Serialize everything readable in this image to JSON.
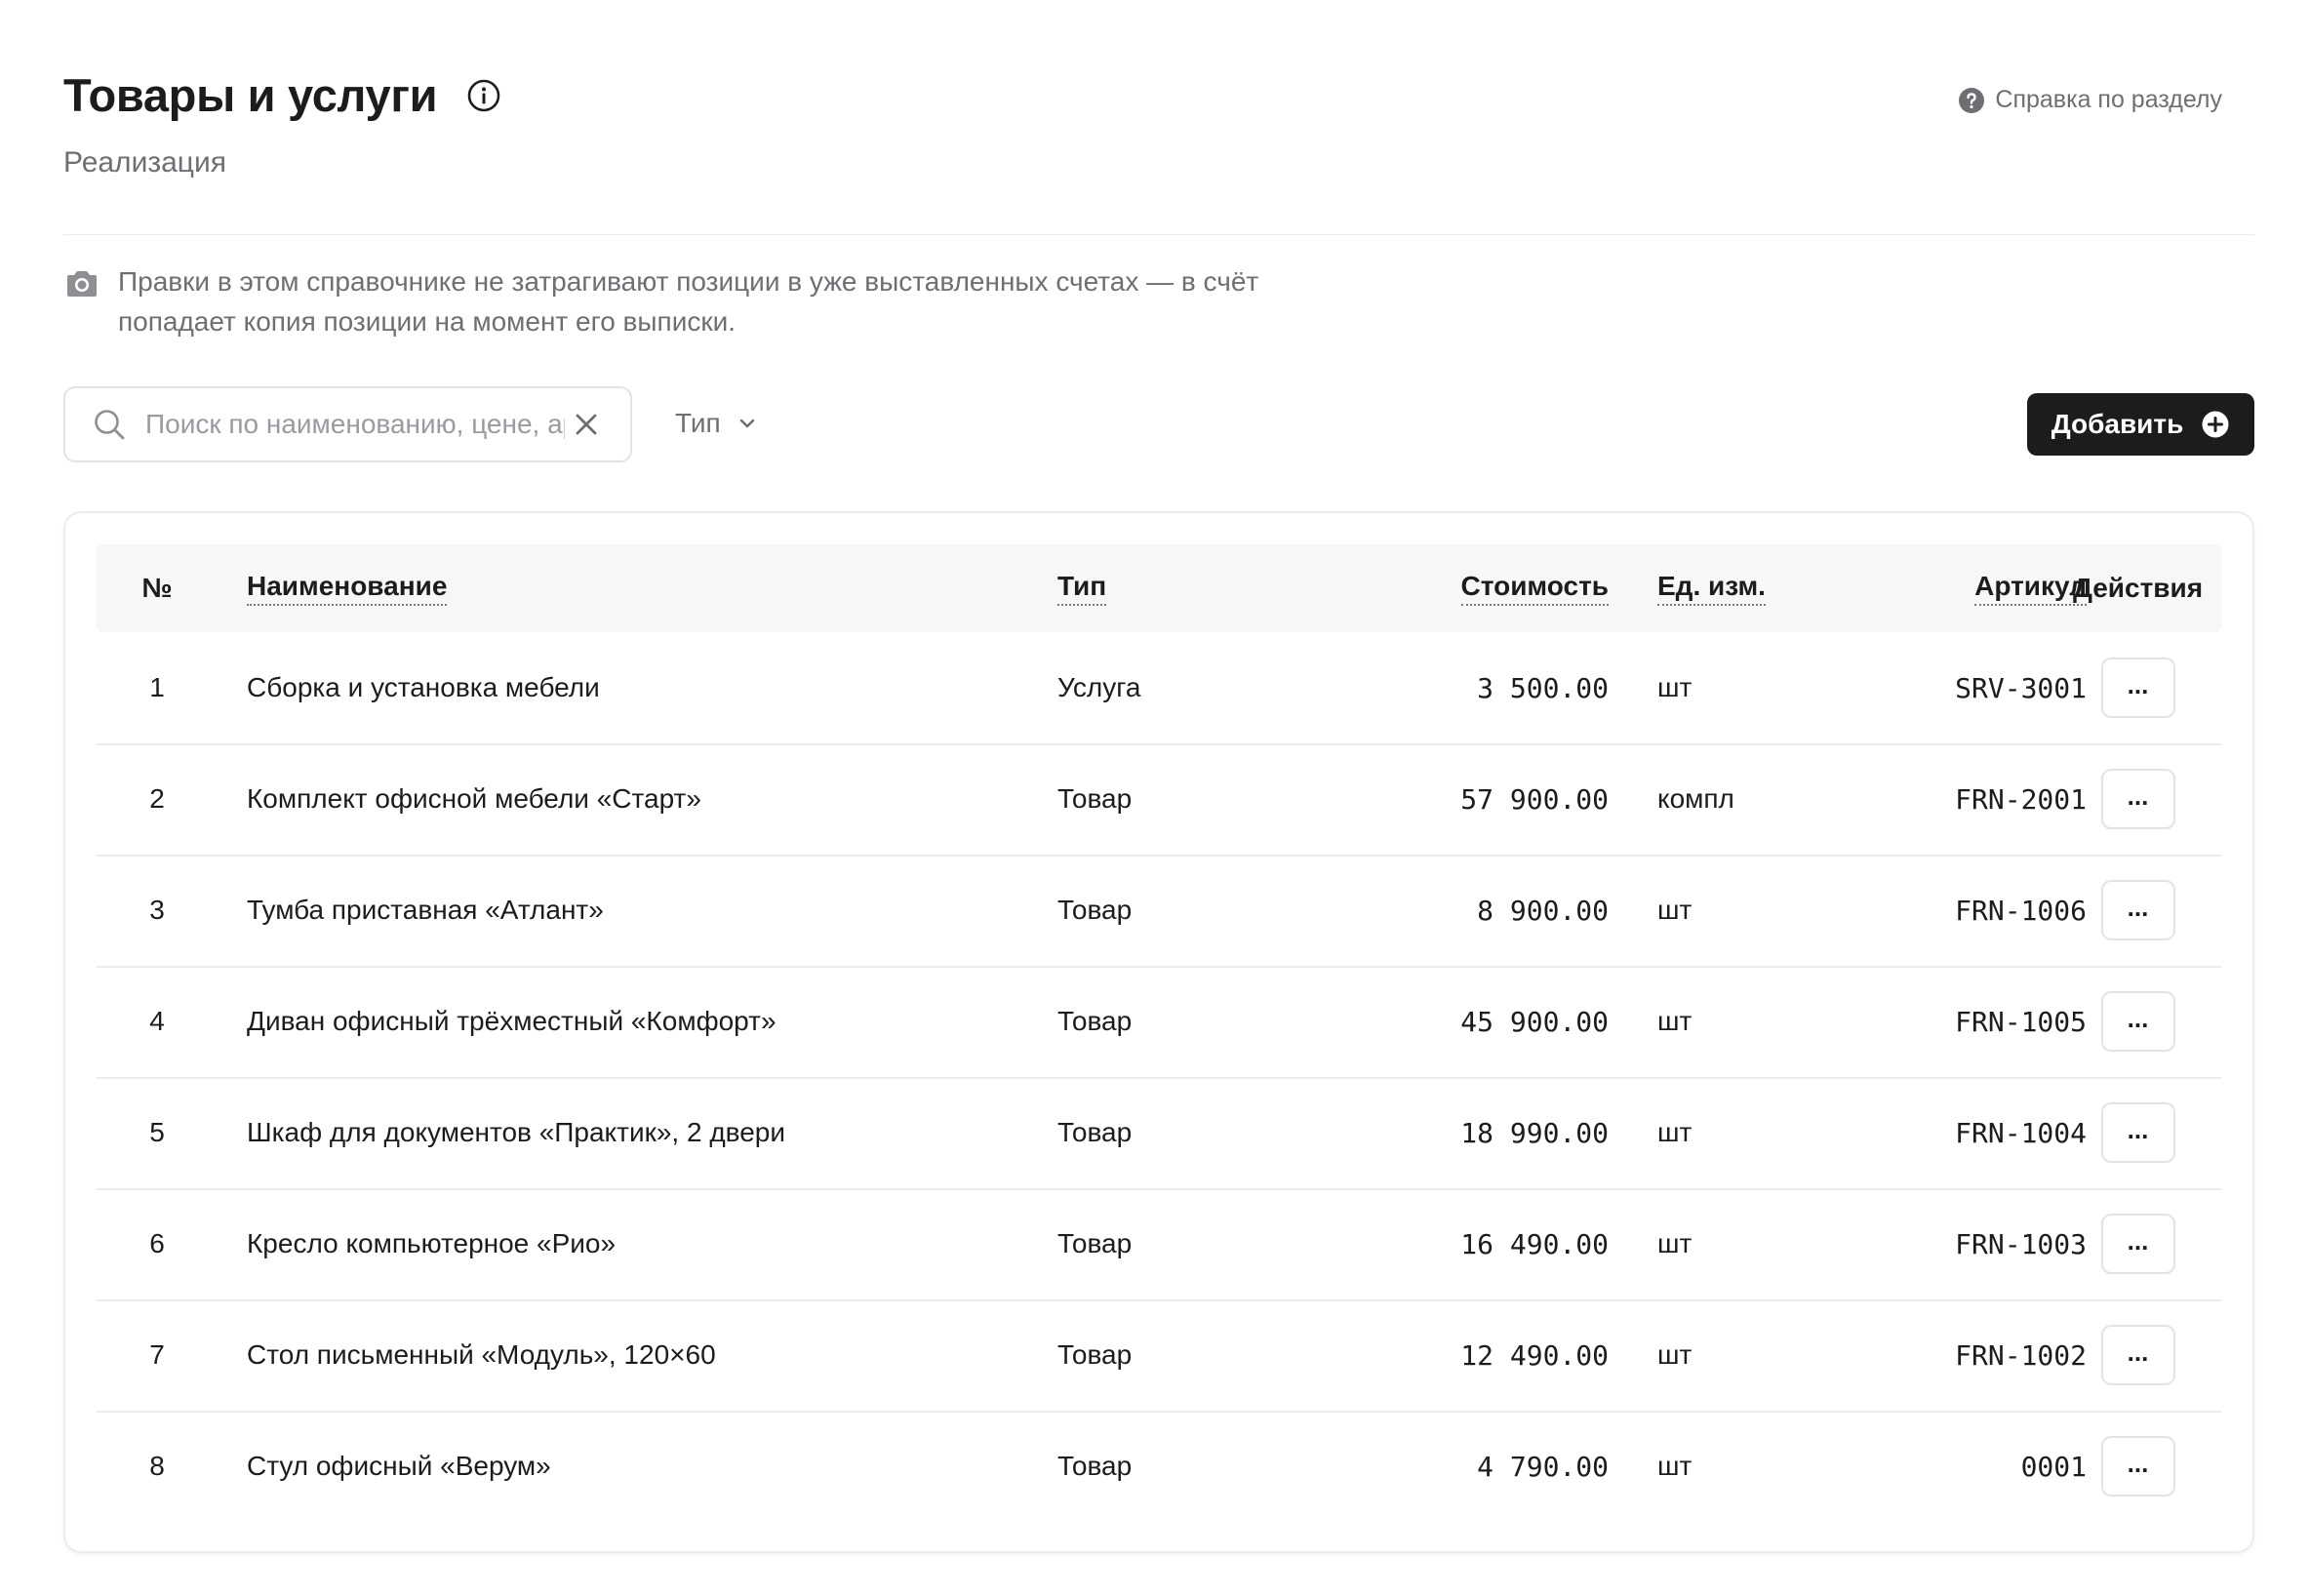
{
  "header": {
    "title": "Товары и услуги",
    "subtitle": "Реализация",
    "help_label": "Справка по разделу"
  },
  "note": {
    "text": "Правки в этом справочнике не затрагивают позиции в уже выставленных счетах — в счёт попадает копия позиции на момент его выписки."
  },
  "toolbar": {
    "search_placeholder": "Поиск по наименованию, цене, артикулу",
    "search_value": "",
    "type_filter_label": "Тип",
    "add_label": "Добавить"
  },
  "table": {
    "columns": {
      "num": "№",
      "name": "Наименование",
      "type": "Тип",
      "price": "Стоимость",
      "unit": "Ед. изм.",
      "sku": "Артикул",
      "actions": "Действия"
    },
    "action_label": "...",
    "rows": [
      {
        "num": "1",
        "name": "Сборка и установка мебели",
        "type": "Услуга",
        "price": "3 500.00",
        "unit": "шт",
        "sku": "SRV-3001"
      },
      {
        "num": "2",
        "name": "Комплект офисной мебели «Старт»",
        "type": "Товар",
        "price": "57 900.00",
        "unit": "компл",
        "sku": "FRN-2001"
      },
      {
        "num": "3",
        "name": "Тумба приставная «Атлант»",
        "type": "Товар",
        "price": "8 900.00",
        "unit": "шт",
        "sku": "FRN-1006"
      },
      {
        "num": "4",
        "name": "Диван офисный трёхместный «Комфорт»",
        "type": "Товар",
        "price": "45 900.00",
        "unit": "шт",
        "sku": "FRN-1005"
      },
      {
        "num": "5",
        "name": "Шкаф для документов «Практик», 2 двери",
        "type": "Товар",
        "price": "18 990.00",
        "unit": "шт",
        "sku": "FRN-1004"
      },
      {
        "num": "6",
        "name": "Кресло компьютерное «Рио»",
        "type": "Товар",
        "price": "16 490.00",
        "unit": "шт",
        "sku": "FRN-1003"
      },
      {
        "num": "7",
        "name": "Стол письменный «Модуль», 120×60",
        "type": "Товар",
        "price": "12 490.00",
        "unit": "шт",
        "sku": "FRN-1002"
      },
      {
        "num": "8",
        "name": "Стул офисный «Верум»",
        "type": "Товар",
        "price": "4 790.00",
        "unit": "шт",
        "sku": "0001"
      }
    ]
  },
  "colors": {
    "primary_button": "#1c1c1e",
    "muted_text": "#6e6e73",
    "header_bg": "#f7f7f9",
    "border": "#ececef"
  }
}
